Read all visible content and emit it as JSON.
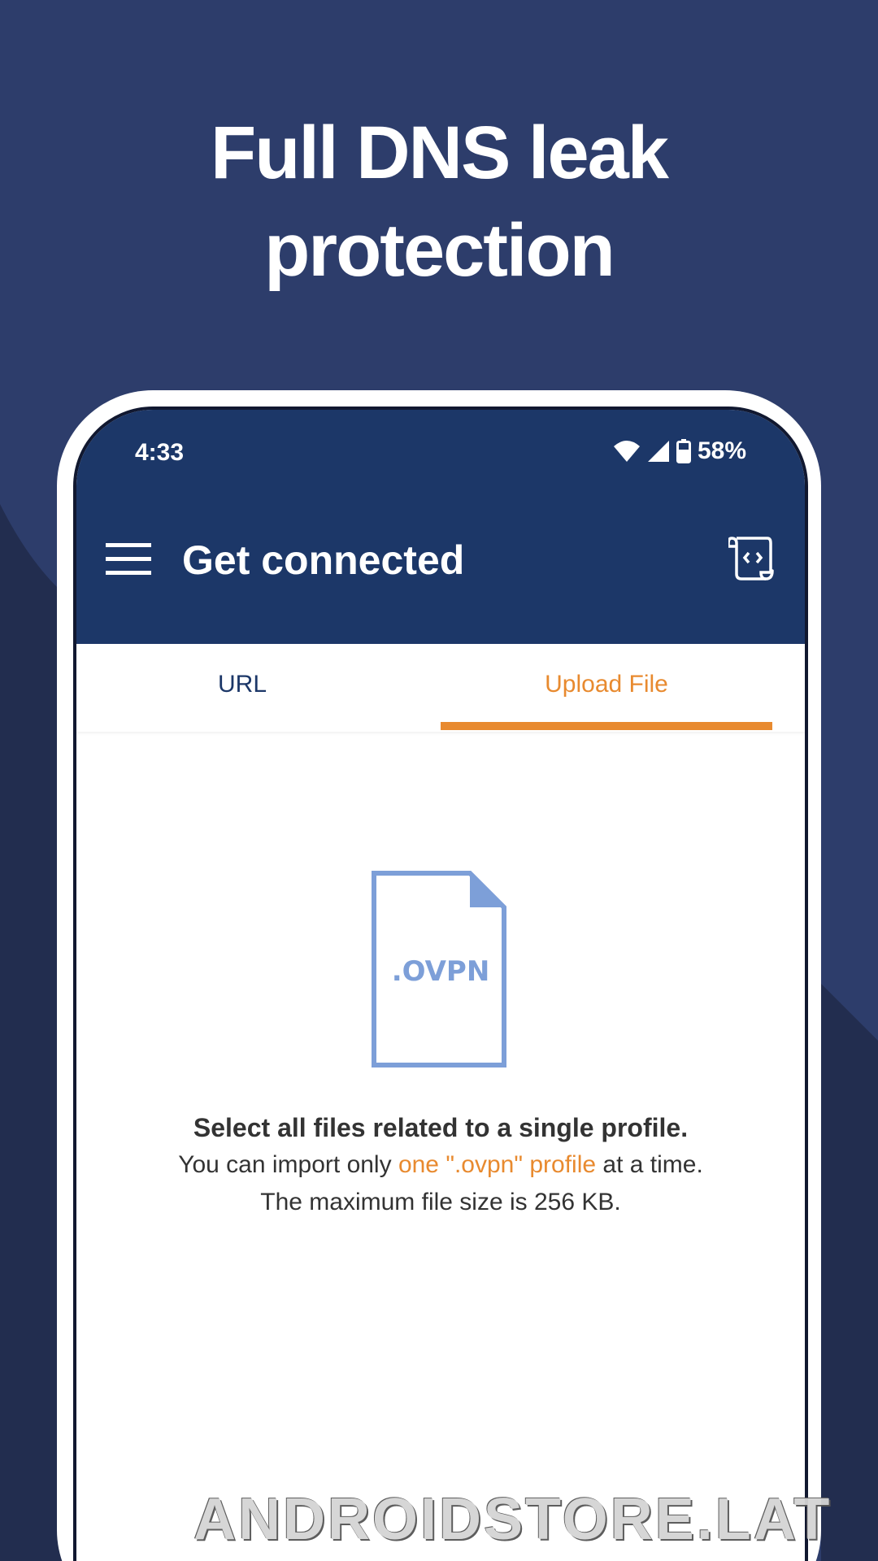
{
  "headline": {
    "line1": "Full DNS leak",
    "line2": "protection"
  },
  "status_bar": {
    "time": "4:33",
    "battery": "58%",
    "icons": [
      "wifi-icon",
      "cell-signal-icon",
      "battery-icon"
    ]
  },
  "toolbar": {
    "title": "Get connected",
    "menu_icon": "hamburger-menu-icon",
    "action_icon": "script-code-icon"
  },
  "tabs": [
    {
      "label": "URL",
      "selected": false
    },
    {
      "label": "Upload File",
      "selected": true
    }
  ],
  "upload": {
    "file_label": ".OVPN",
    "title": "Select all files related to a single profile.",
    "line1_prefix": "You can import only ",
    "line1_accent": "one \".ovpn\" profile",
    "line1_suffix": " at a time.",
    "line2": "The maximum file size is 256 KB."
  },
  "watermark": "ANDROIDSTORE.LAT",
  "colors": {
    "background": "#2d3d6b",
    "appbar": "#1c3768",
    "accent": "#e88a2f",
    "file_icon": "#7d9fd8"
  }
}
